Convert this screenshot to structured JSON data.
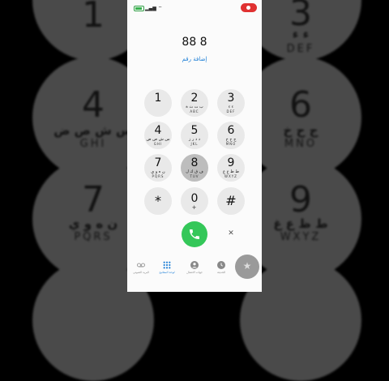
{
  "background_keys": [
    {
      "name": "bg-key-1",
      "digit": "1",
      "arabic": "",
      "english": ""
    },
    {
      "name": "bg-key-3",
      "digit": "3",
      "arabic": "ء ء",
      "english": "DEF"
    },
    {
      "name": "bg-key-4",
      "digit": "4",
      "arabic": "س ش ص ض",
      "english": "GHI"
    },
    {
      "name": "bg-key-6",
      "digit": "6",
      "arabic": "ج ح خ",
      "english": "MNO"
    },
    {
      "name": "bg-key-7",
      "digit": "7",
      "arabic": "ن ه و ي",
      "english": "PQRS"
    },
    {
      "name": "bg-key-9",
      "digit": "9",
      "arabic": "ط ظ ع غ",
      "english": "WXYZ"
    }
  ],
  "dialer": {
    "number": "88 8",
    "add_number": "إضافة رقم"
  },
  "keypad": [
    {
      "digit": "1",
      "arabic": "",
      "english": ""
    },
    {
      "digit": "2",
      "arabic": "ب ت ث ة",
      "english": "ABC"
    },
    {
      "digit": "3",
      "arabic": "ء ء",
      "english": "DEF"
    },
    {
      "digit": "4",
      "arabic": "س ش ص ض",
      "english": "GHI"
    },
    {
      "digit": "5",
      "arabic": "د ذ ر ز",
      "english": "JKL"
    },
    {
      "digit": "6",
      "arabic": "ج ح خ",
      "english": "MNO"
    },
    {
      "digit": "7",
      "arabic": "ن ه و ي",
      "english": "PQRS"
    },
    {
      "digit": "8",
      "arabic": "ف ق ك ل",
      "english": "TUV"
    },
    {
      "digit": "9",
      "arabic": "ط ظ ع غ",
      "english": "WXYZ"
    },
    {
      "digit": "*",
      "arabic": "",
      "english": ""
    },
    {
      "digit": "0",
      "arabic": "",
      "english": "+"
    },
    {
      "digit": "#",
      "arabic": "",
      "english": ""
    }
  ],
  "tabs": [
    {
      "label": "البريد الصوتي",
      "icon": "voicemail-icon",
      "active": false
    },
    {
      "label": "لوحة المفاتيح",
      "icon": "keypad-icon",
      "active": true
    },
    {
      "label": "جهات الاتصال",
      "icon": "contacts-icon",
      "active": false
    },
    {
      "label": "الحديثة",
      "icon": "recents-icon",
      "active": false
    }
  ],
  "colors": {
    "call_green": "#34c759",
    "accent_blue": "#1c7ed6",
    "record_red": "#e03131"
  }
}
